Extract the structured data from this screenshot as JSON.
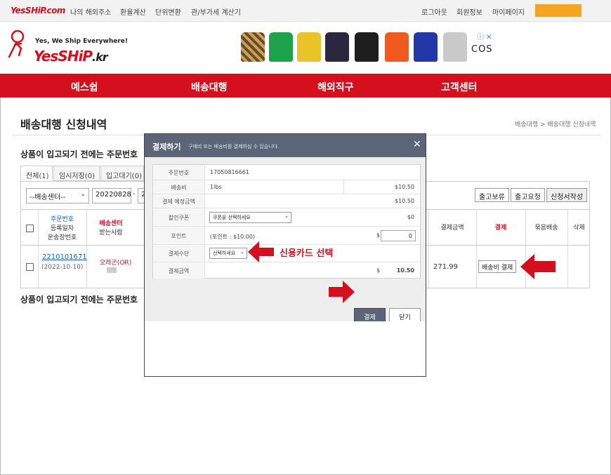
{
  "topbar": {
    "logo": "YesSHiP.com",
    "links": [
      "나의 해외주소",
      "환율계산",
      "단위변환",
      "관/부가세 계산기"
    ],
    "right_links": [
      "로그아웃",
      "회원정보",
      "마이페이지"
    ]
  },
  "header": {
    "tagline": "Yes, We Ship Everywhere!",
    "brand": "YesSHiP",
    "brand_suffix": ".kr",
    "ad_brand": "COS",
    "ad_icons": "ⓘ ✕"
  },
  "nav": [
    "예스쉽",
    "배송대행",
    "해외직구",
    "고객센터"
  ],
  "page": {
    "title": "배송대행 신청내역",
    "breadcrumb": "배송대행 > 배송대행 신청내역",
    "notice_top": "상품이 입고되기 전에는 주문번호",
    "notice_bottom": "상품이 입고되기 전에는 주문번호"
  },
  "tabs": [
    "전체(1)",
    "임시저장(0)",
    "입고대기(0)"
  ],
  "filter": {
    "center_select": "--배송센터--",
    "date_from": "20220828",
    "date_sep": "-",
    "date_to_partial": "2",
    "buttons": [
      "출고보류",
      "출고요청",
      "신청서작성"
    ]
  },
  "table": {
    "headers": {
      "order": [
        "주문번호",
        "등록일자",
        "운송장번호"
      ],
      "center": [
        "배송센터",
        "받는사람"
      ],
      "total": "결제금액",
      "pay": "결제",
      "bundle": "묶음배송",
      "delete": "삭제"
    },
    "row": {
      "order_no": "2210101671",
      "date": "(2022-10-10)",
      "center": "오레곤(OR)",
      "total": "271.99",
      "pay_button": "배송비 결제"
    }
  },
  "modal": {
    "title": "결제하기",
    "subtitle": "구매비 또는 배송비를 결제하실 수 있습니다.",
    "close": "✕",
    "rows": [
      {
        "label": "주문번호",
        "value": "17050816661",
        "amount": ""
      },
      {
        "label": "배송비",
        "value": "1lbs",
        "amount": "$10.50"
      },
      {
        "label": "결제 예정금액",
        "value": "",
        "amount": "$10.50"
      },
      {
        "label": "할인쿠폰",
        "value": "쿠폰을 선택하세요",
        "amount": "$0"
      },
      {
        "label": "포인트",
        "value": "(포인트 : $10.00)",
        "amount": "$",
        "input": "0"
      },
      {
        "label": "결제수단",
        "value": "선택하세요",
        "amount": ""
      },
      {
        "label": "결제금액",
        "value": "",
        "amount": "$",
        "total": "10.50"
      }
    ],
    "pay_button": "결제",
    "close_button": "닫기"
  },
  "annotation": {
    "text": "신용카드 선택",
    "color": "#d40f1e"
  },
  "colors": {
    "brand_red": "#d40f1e",
    "modal_header": "#5b6577",
    "modal_body": "#eeeeee",
    "link_blue": "#1a5fc9"
  }
}
